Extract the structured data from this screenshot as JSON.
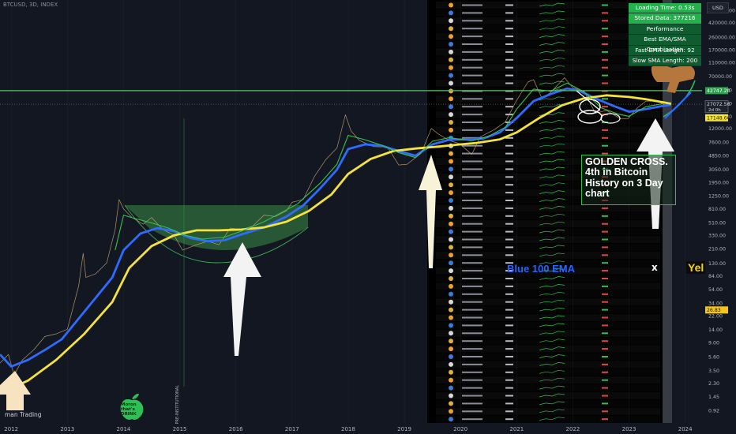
{
  "header": {
    "ticker": "BTCUSD, 3D, INDEX"
  },
  "currency_button": "USD",
  "indicator_panel": {
    "rows": [
      {
        "label": "Loading Time: 0.53s",
        "style": "g"
      },
      {
        "label": "Stored Data: 377216",
        "style": "g"
      },
      {
        "label": "Performance",
        "style": "d"
      },
      {
        "label": "Best EMA/SMA Combination",
        "style": "d"
      },
      {
        "label": "Fast EMA Length: 92",
        "style": "d"
      },
      {
        "label": "Slow SMA Length: 200",
        "style": "d"
      }
    ]
  },
  "annotation": {
    "lines": [
      "GOLDEN CROSS.",
      "4th in Bitcoin",
      "History on 3 Day",
      "chart"
    ]
  },
  "labels": {
    "blue_ema": "Blue 100 EMA",
    "yellow_cut": "Yel",
    "x_mark": "x",
    "watermark": "man Trading",
    "logo_text": "Moron\nthat's\nDRINK",
    "vertical_note": "PRE-INSTITUTIONAL"
  },
  "chart_data": {
    "type": "line",
    "scale": "log",
    "x_ticks": [
      "2012",
      "2013",
      "2014",
      "2015",
      "2016",
      "2017",
      "2018",
      "2019",
      "2020",
      "2021",
      "2022",
      "2023",
      "2024"
    ],
    "y_ticks": [
      "640000.00",
      "420000.00",
      "260000.00",
      "170000.00",
      "110000.00",
      "70000.00",
      "44000.00",
      "28000.00",
      "18000.00",
      "12000.00",
      "7600.00",
      "4850.00",
      "3050.00",
      "1950.00",
      "1250.00",
      "810.00",
      "510.00",
      "330.00",
      "210.00",
      "130.00",
      "84.00",
      "54.00",
      "34.00",
      "22.00",
      "14.00",
      "9.00",
      "5.60",
      "3.50",
      "2.30",
      "1.45",
      "0.92",
      "0.61"
    ],
    "ylim": [
      0.6,
      900000
    ],
    "xlim": [
      2011.8,
      2024.3
    ],
    "price_labels": [
      {
        "text": "42747.20",
        "value": 42747,
        "color": "#2e9e4f"
      },
      {
        "text": "27072.56",
        "sub": "2d 0h",
        "value": 27072,
        "color": "#1e222d"
      },
      {
        "text": "17148.66",
        "value": 17149,
        "color": "#f5e23a"
      },
      {
        "text": "26.83",
        "value": 26.8,
        "color": "#f5c518"
      }
    ],
    "horizontal_lines": [
      {
        "value": 42747,
        "color": "#5fbf6a"
      }
    ],
    "series": [
      {
        "color": "#c9a97a",
        "points": [
          [
            2011.8,
            4.5
          ],
          [
            2011.95,
            6
          ],
          [
            2012.05,
            3
          ],
          [
            2012.2,
            5
          ],
          [
            2012.4,
            7
          ],
          [
            2012.6,
            11
          ],
          [
            2012.8,
            12
          ],
          [
            2013.0,
            14
          ],
          [
            2013.2,
            60
          ],
          [
            2013.28,
            180
          ],
          [
            2013.33,
            80
          ],
          [
            2013.5,
            90
          ],
          [
            2013.7,
            130
          ],
          [
            2013.85,
            400
          ],
          [
            2013.92,
            1100
          ],
          [
            2014.0,
            800
          ],
          [
            2014.15,
            600
          ],
          [
            2014.35,
            480
          ],
          [
            2014.5,
            600
          ],
          [
            2014.7,
            400
          ],
          [
            2014.9,
            330
          ],
          [
            2015.05,
            200
          ],
          [
            2015.3,
            240
          ],
          [
            2015.5,
            270
          ],
          [
            2015.7,
            240
          ],
          [
            2015.9,
            420
          ],
          [
            2016.1,
            400
          ],
          [
            2016.3,
            450
          ],
          [
            2016.5,
            650
          ],
          [
            2016.7,
            620
          ],
          [
            2016.9,
            750
          ],
          [
            2017.0,
            1000
          ],
          [
            2017.2,
            1100
          ],
          [
            2017.4,
            2400
          ],
          [
            2017.6,
            4200
          ],
          [
            2017.8,
            6200
          ],
          [
            2017.95,
            19000
          ],
          [
            2018.05,
            11000
          ],
          [
            2018.2,
            8000
          ],
          [
            2018.45,
            6500
          ],
          [
            2018.7,
            6400
          ],
          [
            2018.9,
            3500
          ],
          [
            2019.05,
            3600
          ],
          [
            2019.3,
            5200
          ],
          [
            2019.48,
            12000
          ],
          [
            2019.6,
            10000
          ],
          [
            2019.8,
            8000
          ],
          [
            2019.98,
            7200
          ],
          [
            2020.2,
            5000
          ],
          [
            2020.35,
            9000
          ],
          [
            2020.6,
            11500
          ],
          [
            2020.8,
            15000
          ],
          [
            2020.98,
            29000
          ],
          [
            2021.2,
            57000
          ],
          [
            2021.3,
            62000
          ],
          [
            2021.45,
            33000
          ],
          [
            2021.6,
            40000
          ],
          [
            2021.85,
            66000
          ],
          [
            2022.0,
            47000
          ],
          [
            2022.2,
            42000
          ],
          [
            2022.4,
            20000
          ],
          [
            2022.6,
            22000
          ],
          [
            2022.85,
            16500
          ],
          [
            2022.98,
            16600
          ],
          [
            2023.15,
            24000
          ],
          [
            2023.3,
            30000
          ],
          [
            2023.5,
            30000
          ],
          [
            2023.65,
            26000
          ],
          [
            2023.7,
            27000
          ]
        ]
      },
      {
        "color": "#2f6bff",
        "points": [
          [
            2011.8,
            6
          ],
          [
            2012.0,
            4
          ],
          [
            2012.3,
            5
          ],
          [
            2012.6,
            7
          ],
          [
            2012.9,
            10
          ],
          [
            2013.2,
            20
          ],
          [
            2013.5,
            40
          ],
          [
            2013.8,
            80
          ],
          [
            2014.0,
            200
          ],
          [
            2014.3,
            350
          ],
          [
            2014.6,
            420
          ],
          [
            2014.9,
            380
          ],
          [
            2015.2,
            300
          ],
          [
            2015.5,
            270
          ],
          [
            2015.8,
            280
          ],
          [
            2016.1,
            340
          ],
          [
            2016.5,
            430
          ],
          [
            2016.9,
            620
          ],
          [
            2017.2,
            900
          ],
          [
            2017.5,
            1600
          ],
          [
            2017.8,
            3000
          ],
          [
            2018.0,
            6000
          ],
          [
            2018.3,
            7000
          ],
          [
            2018.6,
            6700
          ],
          [
            2018.9,
            5600
          ],
          [
            2019.2,
            4800
          ],
          [
            2019.5,
            7000
          ],
          [
            2019.8,
            8200
          ],
          [
            2020.1,
            8300
          ],
          [
            2020.4,
            8500
          ],
          [
            2020.7,
            10500
          ],
          [
            2021.0,
            17000
          ],
          [
            2021.3,
            30000
          ],
          [
            2021.6,
            38000
          ],
          [
            2021.9,
            46000
          ],
          [
            2022.1,
            43000
          ],
          [
            2022.4,
            33000
          ],
          [
            2022.7,
            26000
          ],
          [
            2023.0,
            21000
          ],
          [
            2023.3,
            23000
          ],
          [
            2023.6,
            25500
          ],
          [
            2023.75,
            26500
          ]
        ]
      },
      {
        "color": "#f5e23a",
        "points": [
          [
            2011.8,
            1.6
          ],
          [
            2012.3,
            2.5
          ],
          [
            2012.8,
            5
          ],
          [
            2013.3,
            12
          ],
          [
            2013.8,
            35
          ],
          [
            2014.1,
            110
          ],
          [
            2014.5,
            230
          ],
          [
            2014.9,
            330
          ],
          [
            2015.3,
            390
          ],
          [
            2015.7,
            390
          ],
          [
            2016.1,
            400
          ],
          [
            2016.5,
            430
          ],
          [
            2016.9,
            520
          ],
          [
            2017.3,
            750
          ],
          [
            2017.7,
            1300
          ],
          [
            2018.0,
            2600
          ],
          [
            2018.4,
            4300
          ],
          [
            2018.8,
            5600
          ],
          [
            2019.2,
            6100
          ],
          [
            2019.6,
            6500
          ],
          [
            2019.9,
            6900
          ],
          [
            2020.3,
            7400
          ],
          [
            2020.7,
            8300
          ],
          [
            2021.0,
            10500
          ],
          [
            2021.4,
            17000
          ],
          [
            2021.8,
            26000
          ],
          [
            2022.2,
            33000
          ],
          [
            2022.6,
            36500
          ],
          [
            2023.0,
            34500
          ],
          [
            2023.3,
            32000
          ],
          [
            2023.6,
            29000
          ],
          [
            2023.75,
            27500
          ]
        ]
      },
      {
        "color": "#36c24a",
        "points": [
          [
            2013.85,
            200
          ],
          [
            2014.0,
            650
          ],
          [
            2014.2,
            580
          ],
          [
            2014.5,
            500
          ],
          [
            2014.8,
            420
          ],
          [
            2015.1,
            330
          ],
          [
            2015.4,
            290
          ],
          [
            2015.8,
            310
          ],
          [
            2016.1,
            380
          ],
          [
            2016.5,
            520
          ],
          [
            2016.8,
            700
          ],
          [
            2017.1,
            950
          ],
          [
            2017.5,
            1900
          ],
          [
            2017.8,
            3600
          ],
          [
            2018.0,
            9500
          ],
          [
            2018.3,
            8200
          ],
          [
            2018.6,
            6800
          ],
          [
            2018.9,
            5300
          ],
          [
            2019.2,
            4500
          ],
          [
            2019.5,
            7800
          ],
          [
            2019.8,
            8800
          ],
          [
            2020.2,
            7900
          ],
          [
            2020.5,
            9200
          ],
          [
            2020.8,
            12500
          ],
          [
            2021.0,
            23000
          ],
          [
            2021.3,
            45000
          ],
          [
            2021.6,
            42000
          ],
          [
            2021.9,
            55000
          ],
          [
            2022.2,
            41000
          ],
          [
            2022.5,
            24000
          ],
          [
            2022.8,
            19500
          ],
          [
            2023.0,
            18000
          ],
          [
            2023.3,
            25000
          ],
          [
            2023.6,
            27500
          ]
        ]
      }
    ]
  }
}
